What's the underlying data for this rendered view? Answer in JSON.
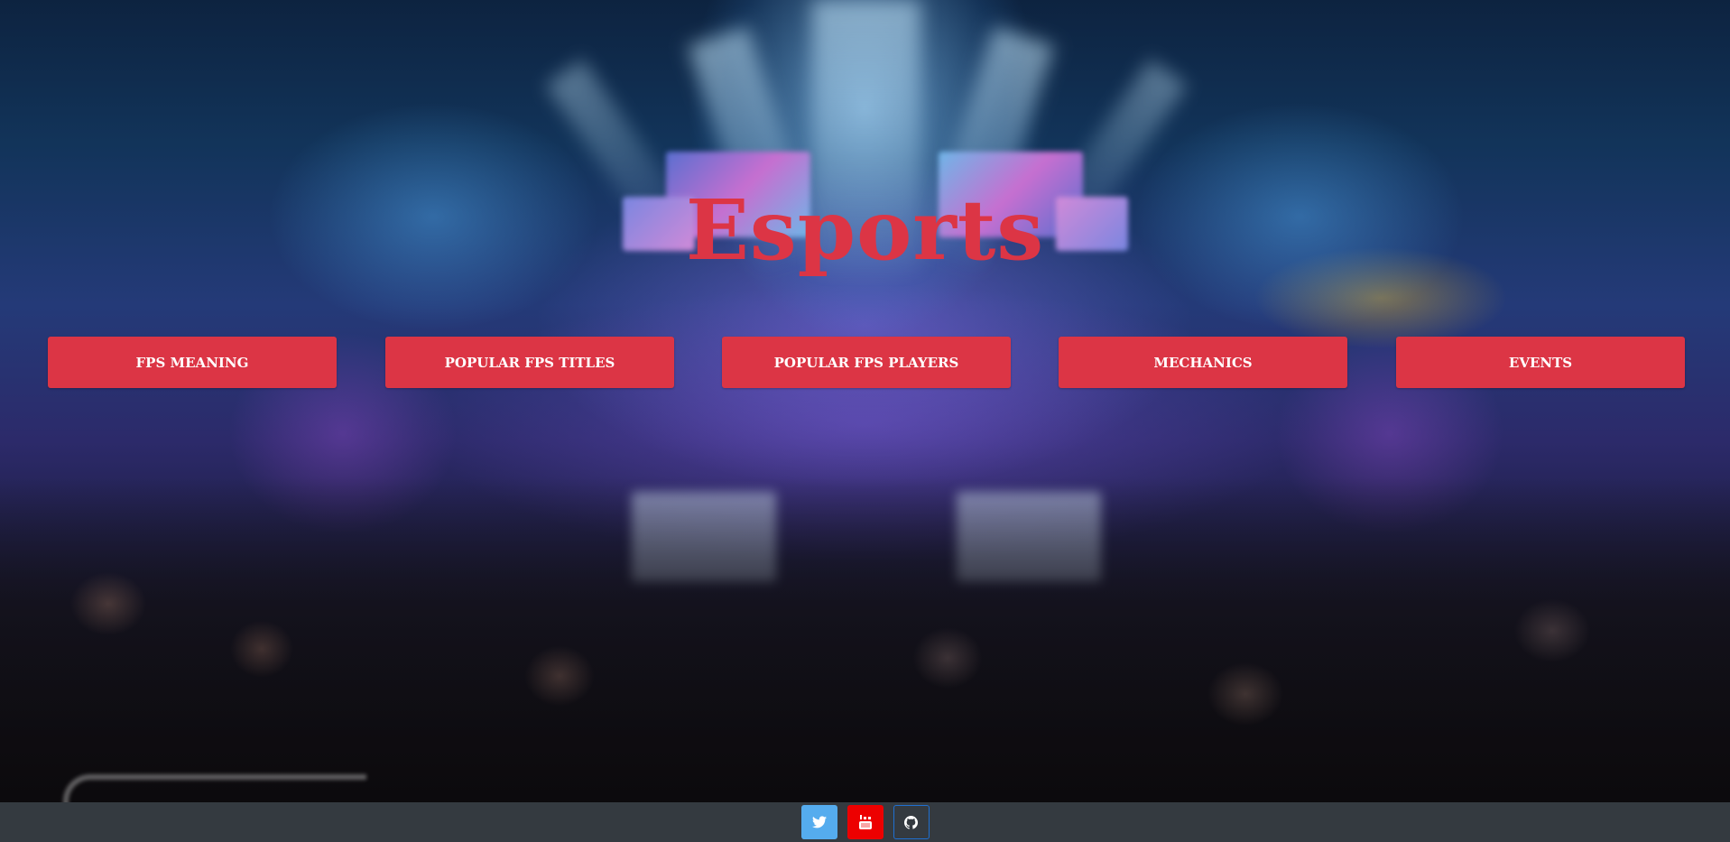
{
  "page": {
    "title": "Esports"
  },
  "nav": {
    "items": [
      {
        "label": "FPS MEANING"
      },
      {
        "label": "POPULAR FPS TITLES"
      },
      {
        "label": "POPULAR FPS PLAYERS"
      },
      {
        "label": "MECHANICS"
      },
      {
        "label": "EVENTS"
      }
    ]
  },
  "footer": {
    "social": [
      {
        "icon": "twitter-icon",
        "color": "#55acee"
      },
      {
        "icon": "youtube-icon",
        "color": "#ed0000"
      },
      {
        "icon": "github-icon",
        "color": "#343a40"
      }
    ]
  },
  "colors": {
    "accent": "#dc3545",
    "footer_bg": "#343a40",
    "button_text": "#ffffff"
  }
}
